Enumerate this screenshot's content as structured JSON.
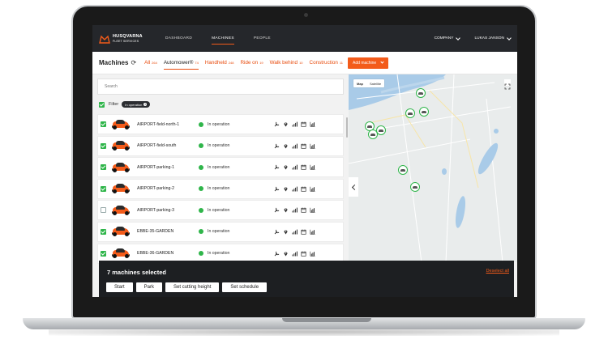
{
  "nav": {
    "brand": "HUSQVARNA",
    "brand_sub": "FLEET SERVICES",
    "links": [
      "DASHBOARD",
      "MACHINES",
      "PEOPLE"
    ],
    "company": "COMPANY",
    "user": "LUKAS JANSON"
  },
  "subheader": {
    "title": "Machines",
    "categories": [
      {
        "label": "All",
        "count": "264"
      },
      {
        "label": "Automower®",
        "count": "74"
      },
      {
        "label": "Handheld",
        "count": "248"
      },
      {
        "label": "Ride on",
        "count": "19"
      },
      {
        "label": "Walk behind",
        "count": "10"
      },
      {
        "label": "Construction",
        "count": "11"
      }
    ],
    "add_button": "Add machine"
  },
  "search": {
    "placeholder": "Search"
  },
  "filter": {
    "label": "Filter",
    "chip": "In operation"
  },
  "machines": [
    {
      "name": "AIRPORT-field-north-1",
      "status": "In operation",
      "checked": true
    },
    {
      "name": "AIRPORT-field-south",
      "status": "In operation",
      "checked": true
    },
    {
      "name": "AIRPORT-parking-1",
      "status": "In operation",
      "checked": true
    },
    {
      "name": "AIRPORT-parking-2",
      "status": "In operation",
      "checked": true
    },
    {
      "name": "AIRPORT-parking-3",
      "status": "In operation",
      "checked": false
    },
    {
      "name": "EBBE-35-GARDEN",
      "status": "In operation",
      "checked": true
    },
    {
      "name": "EBBE-36-GARDEN",
      "status": "In operation",
      "checked": true
    }
  ],
  "map": {
    "toggle": [
      "Map",
      "Satellite"
    ],
    "markers": 9
  },
  "selection": {
    "count_text": "7 machines selected",
    "deselect": "Deselect all",
    "actions": [
      "Start",
      "Park",
      "Set cutting height",
      "Set schedule"
    ]
  },
  "colors": {
    "accent": "#f35b1a",
    "status_ok": "#2fb54a",
    "nav_bg": "#25272b"
  }
}
